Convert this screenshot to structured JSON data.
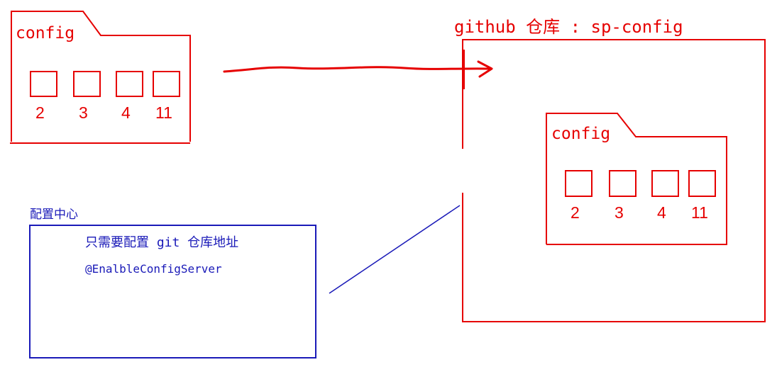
{
  "left_folder": {
    "label": "config",
    "boxes": [
      "2",
      "3",
      "4",
      "11"
    ]
  },
  "repo": {
    "title": "github 仓库 : sp-config",
    "folder": {
      "label": "config",
      "boxes": [
        "2",
        "3",
        "4",
        "11"
      ]
    }
  },
  "config_center": {
    "title": "配置中心",
    "line1": "只需要配置 git 仓库地址",
    "line2": "@EnalbleConfigServer"
  },
  "colors": {
    "red": "#e60000",
    "blue": "#1a1ab8"
  }
}
